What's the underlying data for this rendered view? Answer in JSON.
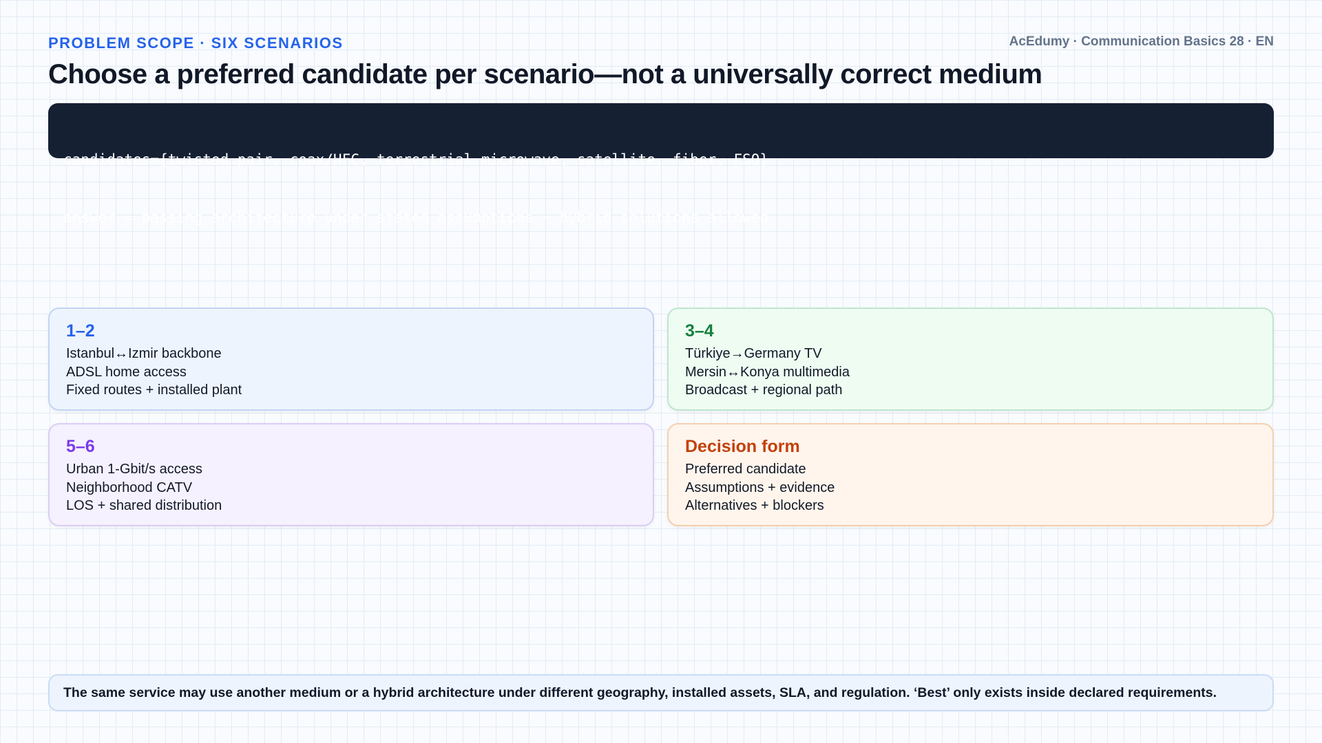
{
  "header": {
    "kicker": "PROBLEM SCOPE · SIX SCENARIOS",
    "brand": "AcEdumy · Communication Basics 28 · EN",
    "title": "Choose a preferred candidate per scenario—not a universally correct medium"
  },
  "code": {
    "lines": [
      "candidates={twisted pair, coax/HFC, terrestrial microwave, satellite, fiber, FSO}",
      "answer = passing architecture under stated assumptions · hybrid solutions allowed"
    ]
  },
  "cards": [
    {
      "title": "1–2",
      "accent": "#2563eb",
      "lines": [
        "Istanbul↔Izmir backbone",
        "ADSL home access",
        "Fixed routes + installed plant"
      ]
    },
    {
      "title": "3–4",
      "accent": "#15803d",
      "lines": [
        "Türkiye→Germany TV",
        "Mersin↔Konya multimedia",
        "Broadcast + regional path"
      ]
    },
    {
      "title": "5–6",
      "accent": "#7c3aed",
      "lines": [
        "Urban 1-Gbit/s access",
        "Neighborhood CATV",
        "LOS + shared distribution"
      ]
    },
    {
      "title": "Decision form",
      "accent": "#c2410c",
      "lines": [
        "Preferred candidate",
        "Assumptions + evidence",
        "Alternatives + blockers"
      ]
    }
  ],
  "footer": {
    "note": "The same service may use another medium or a hybrid architecture under different geography, installed assets, SLA, and regulation. ‘Best’ only exists inside declared requirements."
  }
}
